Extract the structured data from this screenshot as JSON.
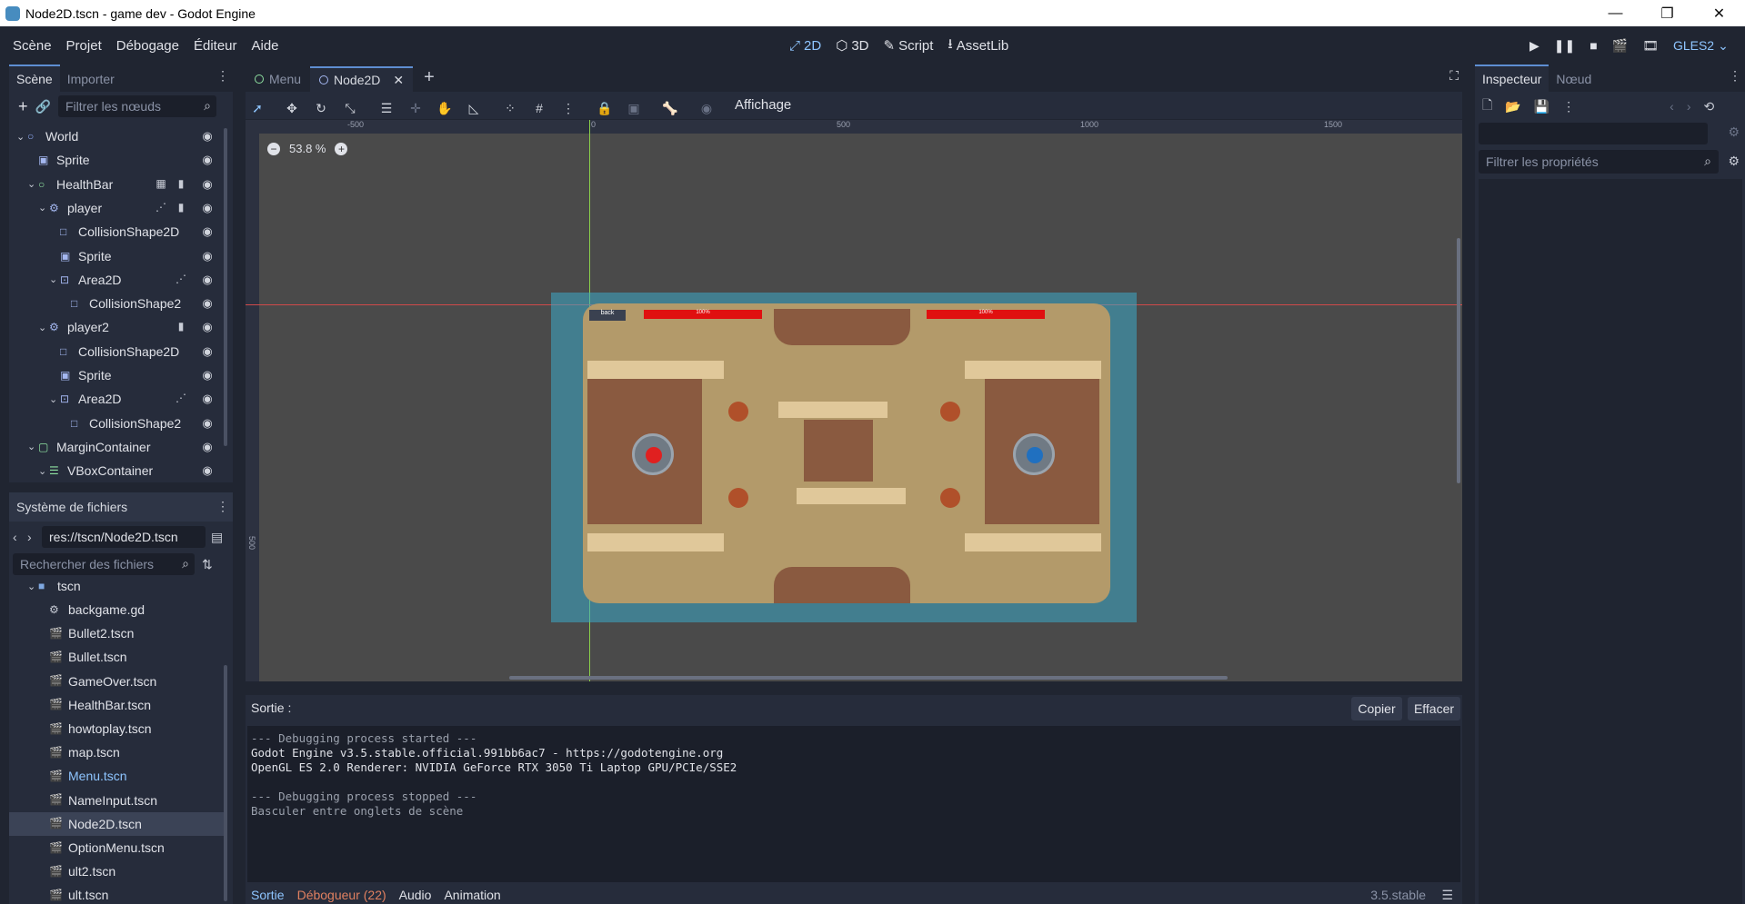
{
  "window": {
    "title": "Node2D.tscn - game dev - Godot Engine",
    "min": "—",
    "max": "❐",
    "close": "✕"
  },
  "menu": {
    "items": [
      "Scène",
      "Projet",
      "Débogage",
      "Éditeur",
      "Aide"
    ]
  },
  "modes": {
    "m2d": "2D",
    "m3d": "3D",
    "script": "Script",
    "assetlib": "AssetLib"
  },
  "renderer": "GLES2",
  "scene_dock": {
    "tabs": [
      "Scène",
      "Importer"
    ],
    "filter_placeholder": "Filtrer les nœuds",
    "tree": [
      {
        "label": "World",
        "depth": 0
      },
      {
        "label": "Sprite",
        "depth": 1
      },
      {
        "label": "HealthBar",
        "depth": 1
      },
      {
        "label": "player",
        "depth": 2
      },
      {
        "label": "CollisionShape2D",
        "depth": 3
      },
      {
        "label": "Sprite",
        "depth": 3
      },
      {
        "label": "Area2D",
        "depth": 3
      },
      {
        "label": "CollisionShape2",
        "depth": 4
      },
      {
        "label": "player2",
        "depth": 2
      },
      {
        "label": "CollisionShape2D",
        "depth": 3
      },
      {
        "label": "Sprite",
        "depth": 3
      },
      {
        "label": "Area2D",
        "depth": 3
      },
      {
        "label": "CollisionShape2",
        "depth": 4
      },
      {
        "label": "MarginContainer",
        "depth": 1
      },
      {
        "label": "VBoxContainer",
        "depth": 2
      }
    ]
  },
  "fs_dock": {
    "title": "Système de fichiers",
    "path": "res://tscn/Node2D.tscn",
    "search_placeholder": "Rechercher des fichiers",
    "folder": "tscn",
    "files": [
      "backgame.gd",
      "Bullet2.tscn",
      "Bullet.tscn",
      "GameOver.tscn",
      "HealthBar.tscn",
      "howtoplay.tscn",
      "map.tscn",
      "Menu.tscn",
      "NameInput.tscn",
      "Node2D.tscn",
      "OptionMenu.tscn",
      "ult2.tscn",
      "ult.tscn"
    ],
    "selected": "Node2D.tscn",
    "highlighted": "Menu.tscn"
  },
  "editor_tabs": [
    "Menu",
    "Node2D"
  ],
  "toolbar": {
    "view_label": "Affichage"
  },
  "viewport": {
    "zoom": "53.8 %",
    "ruler": [
      "-500",
      "0",
      "500",
      "1000",
      "1500"
    ],
    "vruler": [
      "500"
    ],
    "hud_left": "100%",
    "hud_right": "100%",
    "back": "back"
  },
  "output": {
    "label": "Sortie :",
    "copy": "Copier",
    "clear": "Effacer",
    "lines": [
      "--- Debugging process started ---",
      "Godot Engine v3.5.stable.official.991bb6ac7 - https://godotengine.org",
      "OpenGL ES 2.0 Renderer: NVIDIA GeForce RTX 3050 Ti Laptop GPU/PCIe/SSE2",
      "",
      "--- Debugging process stopped ---",
      "Basculer entre onglets de scène"
    ],
    "bottom_tabs": [
      "Sortie",
      "Débogueur (22)",
      "Audio",
      "Animation"
    ],
    "version": "3.5.stable"
  },
  "inspector": {
    "tabs": [
      "Inspecteur",
      "Nœud"
    ],
    "filter_placeholder": "Filtrer les propriétés"
  },
  "colors": {
    "accent": "#5e8ed2",
    "bg": "#202531",
    "panel": "#262c3b",
    "viewport": "#4a4a4a"
  }
}
